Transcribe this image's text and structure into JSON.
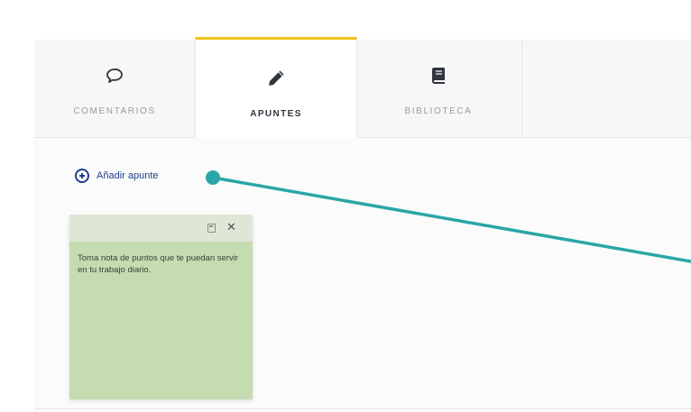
{
  "tabs": [
    {
      "label": "COMENTARIOS",
      "icon": "speech-bubble-icon",
      "active": false
    },
    {
      "label": "APUNTES",
      "icon": "pencil-icon",
      "active": true
    },
    {
      "label": "BIBLIOTECA",
      "icon": "book-icon",
      "active": false
    }
  ],
  "add_note": {
    "label": "Añadir apunte",
    "icon": "plus-circle-icon"
  },
  "note": {
    "text": "Toma nota de puntos que te puedan servir en tu trabajo diario.",
    "save_icon": "save-icon",
    "close_icon": "close-icon"
  },
  "colors": {
    "active_tab_accent": "#f0c419",
    "link": "#1d3f8a",
    "note_bg": "#c5dcb1",
    "pointer": "#2aa6a6"
  }
}
